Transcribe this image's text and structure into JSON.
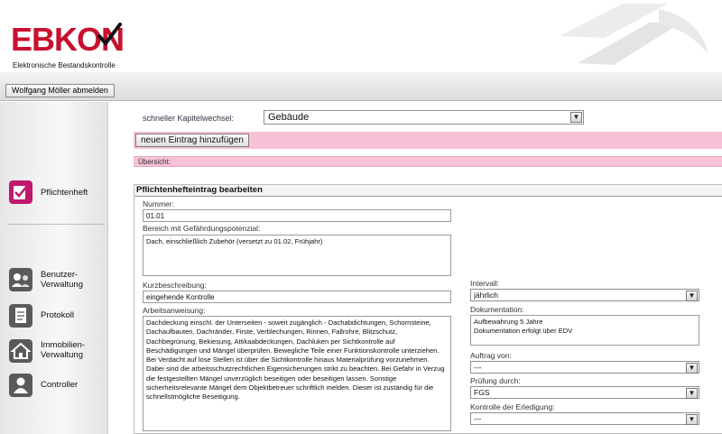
{
  "header": {
    "logo_text": "EBKON",
    "logo_tagline": "Elektronische Bestandskontrolle",
    "logout_label": "Wolfgang Möller abmelden"
  },
  "sidebar": {
    "items": [
      {
        "label": "Pflichtenheft",
        "icon": "checklist-icon",
        "color": "#c0186c"
      },
      {
        "label": "Benutzer-\nVerwaltung",
        "icon": "users-icon",
        "color": "#5a5a5a"
      },
      {
        "label": "Protokoll",
        "icon": "document-icon",
        "color": "#5a5a5a"
      },
      {
        "label": "Immobilien-\nVerwaltung",
        "icon": "house-icon",
        "color": "#5a5a5a"
      },
      {
        "label": "Controller",
        "icon": "person-icon",
        "color": "#5a5a5a"
      }
    ]
  },
  "main": {
    "chapter_label": "schneller Kapitelwechsel:",
    "chapter_value": "Gebäude",
    "new_entry_label": "neuen Eintrag hinzufügen",
    "overview_label": "Übersicht:"
  },
  "form": {
    "title": "Pflichtenhefteintrag bearbeiten",
    "nummer_label": "Nummer:",
    "nummer_value": "01.01",
    "bereich_label": "Bereich mit Gefährdungspotenzial:",
    "bereich_value": "Dach, einschließlich Zubehör (versetzt zu 01.02, Frühjahr)",
    "kurz_label": "Kurzbeschreibung:",
    "kurz_value": "eingehende Kontrolle",
    "arbeit_label": "Arbeitsanweisung:",
    "arbeit_value": "Dachdeckung einschl. der Unterseiten - soweit zugänglich - Dachabdichtungen, Schornsteine, Dachaufbauten, Dachränder, Firste, Verblechungen, Rinnen, Fallrohre, Blitzschutz, Dachbegrünung, Bekiesung, Attikaabdeckungen, Dachluken per Sichtkontrolle auf Beschädigungen und Mängel überprüfen. Bewegliche Teile einer Funktionskontrolle unterziehen. Bei Verdacht auf lose Stellen ist über die Sichtkontrolle hinaus Materialprüfung vorzunehmen. Dabei sind die arbeitsschutzrechtlichen Eigensicherungen strikt zu beachten. Bei Gefahr in Verzug die festgestellten Mängel unverzüglich beseitigen oder beseitigen lassen. Sonstige sicherheitsrelevante Mängel dem Objektbetreuer schriftlich melden. Dieser ist zuständig für die schnellstmögliche Beseitigung.",
    "intervall_label": "Intervall:",
    "intervall_value": "jährlich",
    "doku_label": "Dokumentation:",
    "doku_value": "Aufbewahrung 5 Jahre\nDokumentation erfolgt über EDV",
    "auftrag_label": "Auftrag von:",
    "auftrag_value": "---",
    "pruefung_label": "Prüfung durch:",
    "pruefung_value": "FGS",
    "kontrolle_label": "Kontrolle der Erledigung:",
    "kontrolle_value": "---"
  },
  "colors": {
    "brand_red": "#c8102e",
    "pink_band": "#f7c1d7",
    "active_icon": "#c0186c"
  }
}
